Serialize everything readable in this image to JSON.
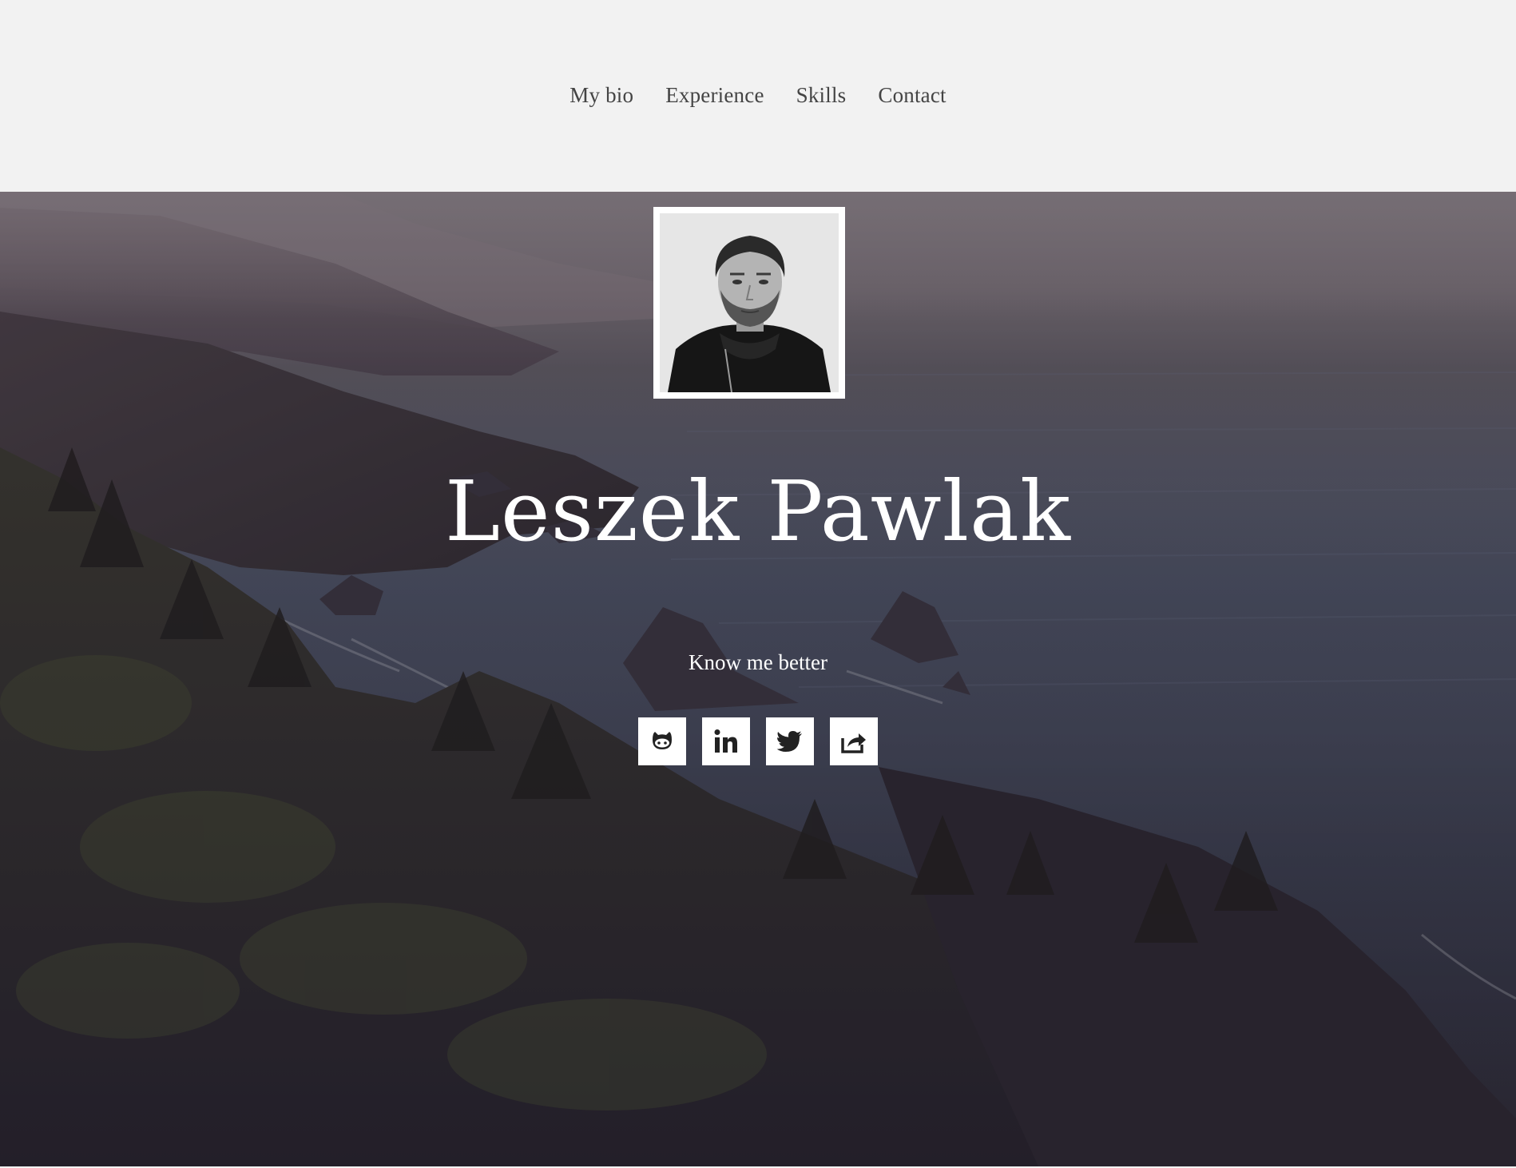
{
  "nav": {
    "items": [
      {
        "label": "My bio"
      },
      {
        "label": "Experience"
      },
      {
        "label": "Skills"
      },
      {
        "label": "Contact"
      }
    ]
  },
  "hero": {
    "name": "Leszek Pawlak",
    "cta": "Know me better",
    "portrait_icon": "portrait-photo",
    "socials": [
      {
        "icon": "github-icon"
      },
      {
        "icon": "linkedin-icon"
      },
      {
        "icon": "twitter-icon"
      },
      {
        "icon": "share-icon"
      }
    ]
  },
  "colors": {
    "nav_bg": "#f2f2f2",
    "nav_text": "#444444",
    "hero_text": "#ffffff",
    "icon_bg": "#ffffff",
    "icon_fg": "#222222"
  }
}
